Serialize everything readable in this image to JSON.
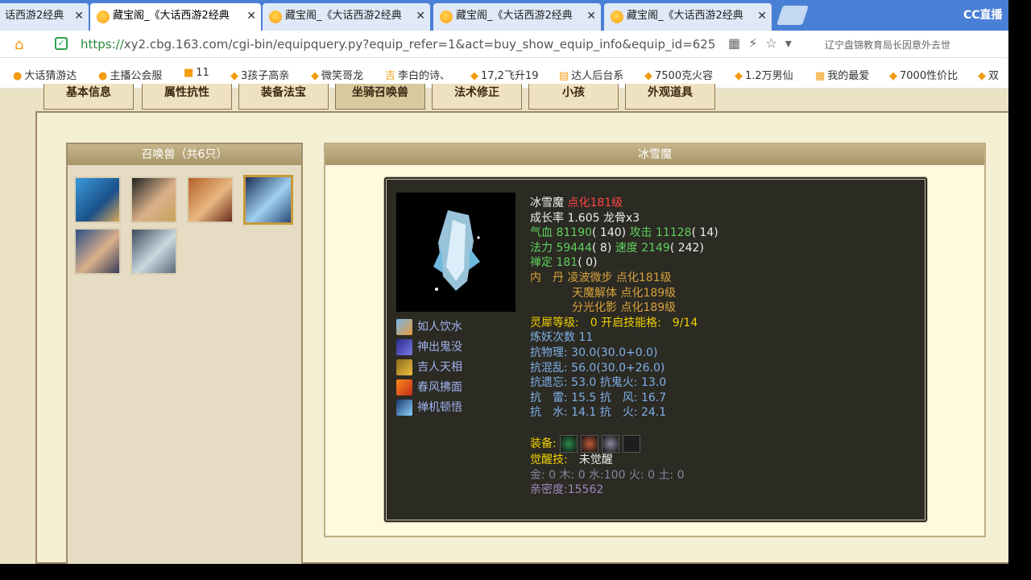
{
  "browser": {
    "tabs": [
      {
        "label": "话西游2经典",
        "active": false
      },
      {
        "label": "藏宝阁_《大话西游2经典",
        "active": true
      },
      {
        "label": "藏宝阁_《大话西游2经典",
        "active": false
      },
      {
        "label": "藏宝阁_《大话西游2经典",
        "active": false
      },
      {
        "label": "藏宝阁_《大话西游2经典",
        "active": false
      }
    ],
    "cc_label": "CC直播",
    "url_prefix": "https://",
    "url_rest": "xy2.cbg.163.com/cgi-bin/equipquery.py?equip_refer=1&act=buy_show_equip_info&equip_id=625",
    "news": "辽宁盘锦教育局长因意外去世",
    "bookmarks": [
      "大话猜游达",
      "主播公会服",
      "11",
      "3孩子高亲",
      "微笑哥龙",
      "李白的诗、",
      "17,2飞升19",
      "达人后台系",
      "7500克火容",
      "1.2万男仙",
      "我的最爱",
      "7000性价比",
      "双"
    ]
  },
  "page_tabs": [
    "基本信息",
    "属性抗性",
    "装备法宝",
    "坐骑召唤兽",
    "法术修正",
    "小孩",
    "外观道具"
  ],
  "left_panel": {
    "title": "召唤兽（共6只）"
  },
  "right_panel": {
    "title": "冰雪魔"
  },
  "pet": {
    "name": "冰雪魔",
    "level": "点化181级",
    "growth_label": "成长率",
    "growth": "1.605",
    "bone": "龙骨x3",
    "hp_label": "气血",
    "hp": "81190",
    "hp_pts": "( 140)",
    "atk_label": "攻击",
    "atk": "11128",
    "atk_pts": "( 14)",
    "mp_label": "法力",
    "mp": "59444",
    "mp_pts": "( 8)",
    "spd_label": "速度",
    "spd": "2149",
    "spd_pts": "( 242)",
    "def_label": "禅定",
    "def": "181",
    "def_pts": "( 0)",
    "dan_label": "内　丹",
    "dan": [
      "凌波微步 点化181级",
      "天魔解体 点化189级",
      "分光化影 点化189级"
    ],
    "spirit": "灵犀等级:　0 开启技能格:　9/14",
    "refine": "炼妖次数 11",
    "res": [
      "抗物理: 30.0(30.0+0.0)",
      "抗混乱: 56.0(30.0+26.0)",
      "抗遗忘: 53.0 抗鬼火: 13.0",
      "抗　雷: 15.5 抗　风: 16.7",
      "抗　水: 14.1 抗　火: 24.1"
    ],
    "equip_label": "装备:",
    "awaken_label": "觉醒技:",
    "awaken": "未觉醒",
    "elements": "金: 0 木: 0 水:100 火: 0 土: 0",
    "intimacy": "亲密度:15562",
    "skills": [
      "如人饮水",
      "神出鬼没",
      "吉人天相",
      "春风拂面",
      "禅机顿悟"
    ]
  },
  "colors": {
    "accent": "#4a7fd6",
    "panel": "#2b2a23"
  }
}
